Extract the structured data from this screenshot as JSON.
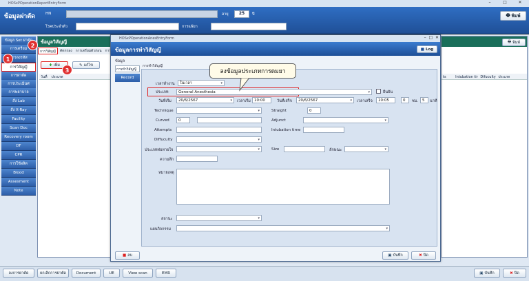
{
  "main_window": {
    "title": "HOSxPOperationReportEntryForm"
  },
  "header": {
    "title": "ข้อมูลผ่าตัด",
    "hn_label": "HN",
    "age_label": "อายุ",
    "age_value": "25",
    "age_unit": "ปี",
    "diag_label": "โรคประจำตัว",
    "allergy_label": "การแพ้ยา",
    "print_label": "พิมพ์"
  },
  "sidebar": {
    "items": [
      "ข้อมูล Set ผ่าตัด",
      "การเตรียม",
      "การลงรหัส",
      "การวิสัญญี",
      "การผ่าตัด",
      "การประเมินศ",
      "การพยาบาล",
      "สั่ง Lab",
      "สั่ง X-Ray",
      "Facility",
      "Scan Doc",
      "Recovery room",
      "DF",
      "CPR",
      "การใช้ผลิต",
      "Blood",
      "Assesment",
      "Note"
    ]
  },
  "anes_panel": {
    "title": "ข้อมูลวิสัญญี",
    "tabs": [
      "การวิสัญญี",
      "คัดกรอง",
      "การเตรียมตัวก่อน",
      "การ"
    ],
    "add_label": "เพิ่ม",
    "edit_label": "แก้ไข",
    "col_date": "วันที่",
    "col_type": "ประเภท"
  },
  "entry_form": {
    "window_title": "HOSxPOperationAnesEntryForm",
    "header": "ข้อมูลการทำวิสัญญี",
    "log_label": "Log",
    "section_label": "ข้อมูล",
    "side_tabs": [
      "การทำวิสัญญี",
      "Record"
    ],
    "main_tab": "การทำวิสัญญี",
    "fields": {
      "time_label": "เวลาทำงาน",
      "time_value": "ในเวลา",
      "type_label": "ประเภท",
      "type_value": "General Anesthesia",
      "confirm_label": "ยืนยัน",
      "start_date_label": "วันที่เริ่ม",
      "start_date": "20/6/2567",
      "start_time_label": "เวลาเริ่ม",
      "start_time": "10:00",
      "end_date_label": "วันที่เสร็จ",
      "end_date": "20/6/2567",
      "end_time_label": "เวลาเสร็จ",
      "end_time": "10:05",
      "hours": "0",
      "hours_label": "ชม.",
      "minutes": "5",
      "minutes_label": "นาที",
      "technique_label": "Technique",
      "straight_label": "Straight",
      "straight_value": "0",
      "curved_label": "Curved",
      "curved_value": "0",
      "adjunct_label": "Adjunct",
      "attempts_label": "Attempts",
      "intubation_label": "Intubation time",
      "difficulty_label": "Diffuculty",
      "tube_type_label": "ประเภทท่อหายใจ",
      "size_label": "Size",
      "cuff_label": "ลักษณะ",
      "depth_label": "ความลึก",
      "note_label": "หมายเหตุ",
      "status_label": "สถานะ",
      "doctor_label": "แผนกิจกรรม"
    },
    "delete_label": "ลบ",
    "save_label": "บันทึก",
    "close_label": "ปิด"
  },
  "callout": {
    "text": "ลงข้อมูลประเภทการดมยา"
  },
  "steps": [
    "1",
    "2",
    "3"
  ],
  "right_panel": {
    "print_label": "พิมพ์",
    "col1": "ts",
    "col2": "Intubation tir",
    "col3": "Difuculty",
    "col4": "ประเภท"
  },
  "bottom_bar": {
    "buttons": [
      "ลงการผ่าตัด",
      "ยกเลิกการผ่าตัด",
      "Document",
      "UE",
      "View scan",
      "EMR"
    ],
    "save_label": "บันทึก",
    "close_label": "ปิด"
  }
}
